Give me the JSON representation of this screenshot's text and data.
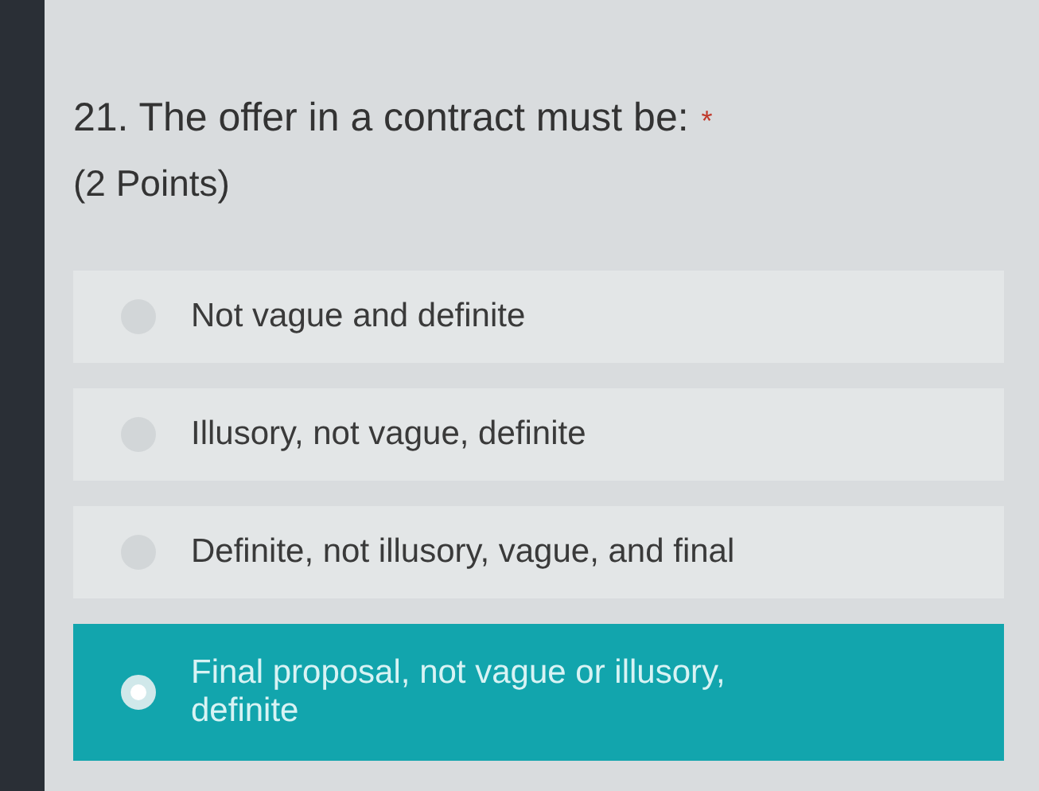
{
  "question": {
    "title": "21. The offer in a contract must be:",
    "required_mark": "*",
    "points": "(2 Points)"
  },
  "options": [
    {
      "label": "Not vague and definite",
      "selected": false
    },
    {
      "label": "Illusory, not vague, definite",
      "selected": false
    },
    {
      "label": "Definite, not illusory, vague, and final",
      "selected": false
    },
    {
      "label": "Final proposal, not vague or illusory, definite",
      "selected": true
    }
  ]
}
